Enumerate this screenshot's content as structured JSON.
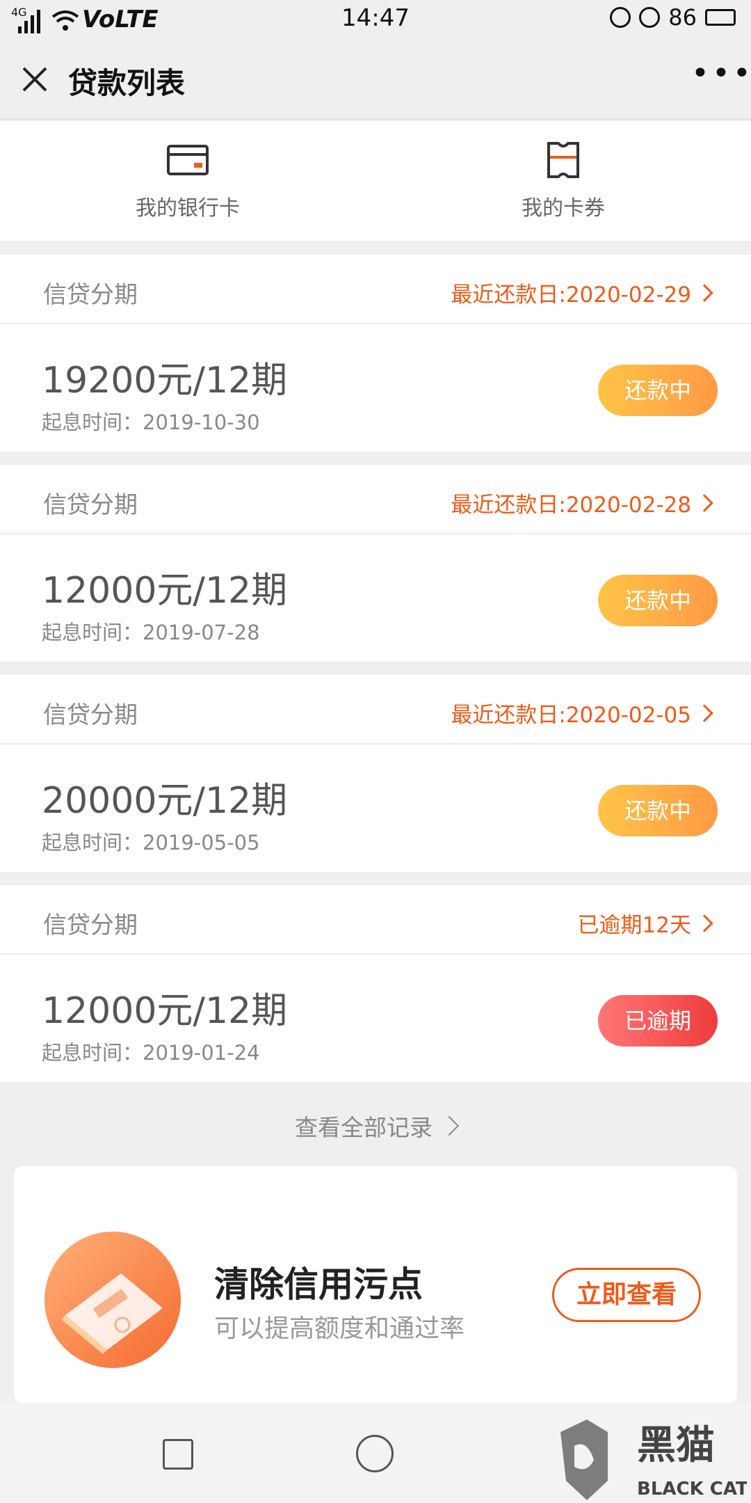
{
  "status_bar": {
    "network": "4G",
    "carrier": "VoLTE",
    "time": "14:47",
    "battery": "86"
  },
  "nav": {
    "title": "贷款列表"
  },
  "quick_links": [
    {
      "label": "我的银行卡",
      "icon": "bank-card-icon"
    },
    {
      "label": "我的卡券",
      "icon": "coupon-icon"
    }
  ],
  "loans": [
    {
      "type": "信贷分期",
      "due": "最近还款日:2020-02-29",
      "amount": "19200元/12期",
      "start": "起息时间：2019-10-30",
      "status": "还款中",
      "overdue": false
    },
    {
      "type": "信贷分期",
      "due": "最近还款日:2020-02-28",
      "amount": "12000元/12期",
      "start": "起息时间：2019-07-28",
      "status": "还款中",
      "overdue": false
    },
    {
      "type": "信贷分期",
      "due": "最近还款日:2020-02-05",
      "amount": "20000元/12期",
      "start": "起息时间：2019-05-05",
      "status": "还款中",
      "overdue": false
    },
    {
      "type": "信贷分期",
      "due": "已逾期12天",
      "amount": "12000元/12期",
      "start": "起息时间：2019-01-24",
      "status": "已逾期",
      "overdue": true
    }
  ],
  "view_all": "查看全部记录",
  "promo": {
    "title": "清除信用污点",
    "subtitle": "可以提高额度和通过率",
    "button": "立即查看"
  },
  "watermark": {
    "cn": "黑猫",
    "en": "BLACK CAT"
  },
  "colors": {
    "accent": "#f05a17",
    "pill_ok": "#ffb347",
    "pill_overdue": "#ef3c3c",
    "background": "#efefef"
  }
}
